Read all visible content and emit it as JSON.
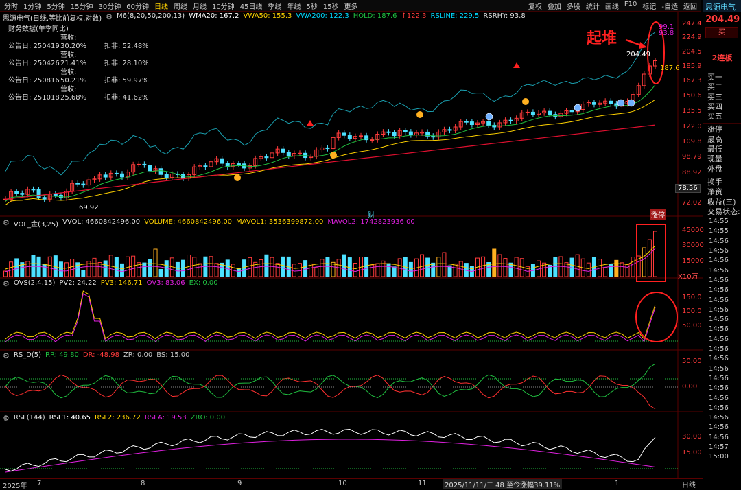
{
  "toolbar": {
    "periods": [
      "分时",
      "1分钟",
      "5分钟",
      "15分钟",
      "30分钟",
      "60分钟",
      "日线",
      "周线",
      "月线",
      "10分钟",
      "45日线",
      "季线",
      "年线",
      "5秒",
      "15秒",
      "更多"
    ],
    "active_period": "日线",
    "tools": [
      "复权",
      "叠加",
      "多股",
      "统计",
      "画线",
      "F10",
      "标记",
      "-自选",
      "返回"
    ]
  },
  "main": {
    "title": "思源电气(日线,等比前复权,对数)",
    "indicator_name": "M6(8,20,50,200,13)",
    "wma20": "WMA20: 167.2",
    "vwa50": "VWA50: 155.3",
    "vwa200": "VWA200: 122.3",
    "hold": "HOLD: 187.6",
    "hold_sep": "↑122.3",
    "rsline": "RSLINE: 229.5",
    "rsrhy": "RSRHY: 93.8",
    "y_labels": [
      "247.4",
      "224.9",
      "204.5",
      "185.9",
      "167.3",
      "150.6",
      "135.5",
      "122.0",
      "109.8",
      "98.79",
      "88.92",
      "78.56",
      "72.02"
    ],
    "low_label": "69.92",
    "hi_label": "204.49",
    "hold_label": "187.6",
    "r_label1": "99.1",
    "r_label2": "93.8",
    "cai_label": "财",
    "zhangting_label": "涨停",
    "annotation": "起堆"
  },
  "financials": {
    "title": "财务数据(单季同比)",
    "rows": [
      {
        "date": "公告日: 250419",
        "rev": "营收: 30.20%",
        "np": "扣非: 52.48%"
      },
      {
        "date": "公告日: 250426",
        "rev": "营收: 21.41%",
        "np": "扣非: 28.10%"
      },
      {
        "date": "公告日: 250816",
        "rev": "营收: 50.21%",
        "np": "扣非: 59.97%"
      },
      {
        "date": "公告日: 251018",
        "rev": "营收: 25.68%",
        "np": "扣非: 41.62%"
      }
    ]
  },
  "vol": {
    "name": "VOL_金(3,25)",
    "vvol": "VVOL: 4660842496.00",
    "volume": "VOLUME: 4660842496.00",
    "mavol1": "MAVOL1: 3536399872.00",
    "mavol2": "MAVOL2: 1742823936.00",
    "y_labels": [
      "45000",
      "30000",
      "15000"
    ],
    "unit": "X10万"
  },
  "ovs": {
    "name": "OVS(2,4,15)",
    "pv2": "PV2: 24.22",
    "pv3": "PV3: 146.71",
    "ov3": "OV3: 83.06",
    "ex": "EX: 0.00",
    "y_labels": [
      "150.0",
      "100.0",
      "50.00"
    ]
  },
  "rsd": {
    "name": "RS_D(5)",
    "rr": "RR: 49.80",
    "dr": "DR: -48.98",
    "zr": "ZR: 0.00",
    "bs": "BS: 15.00",
    "y_labels": [
      "50.00",
      "0.00"
    ]
  },
  "rsl": {
    "name": "RSL(144)",
    "rsl1": "RSL1: 40.65",
    "rsl2": "RSL2: 236.72",
    "rsla": "RSLA: 19.53",
    "zro": "ZRO: 0.00",
    "y_labels": [
      "30.00",
      "15.00"
    ]
  },
  "xaxis": {
    "year": "2025年",
    "months": [
      "7",
      "8",
      "9",
      "10",
      "11",
      "1"
    ],
    "status": "2025/11/11/二 48 至今涨幅39.11%",
    "day": "日线"
  },
  "right_panel": {
    "name": "思源电气",
    "price": "204.49",
    "buy": "买",
    "board": "2连板",
    "orders": [
      "买一",
      "买二",
      "买三",
      "买四",
      "买五"
    ],
    "fields": [
      "涨停",
      "最高",
      "最低",
      "现量",
      "外盘"
    ],
    "fields2": [
      "换手",
      "净资",
      "收益(三)"
    ],
    "status": "交易状态: 连续",
    "times": [
      "14:55",
      "14:55",
      "14:56",
      "14:56",
      "14:56",
      "14:56",
      "14:56",
      "14:56",
      "14:56",
      "14:56",
      "14:56",
      "14:56",
      "14:56",
      "14:56",
      "14:56",
      "14:56",
      "14:56",
      "14:56",
      "14:56",
      "14:56",
      "14:56",
      "14:56",
      "14:56",
      "14:57",
      "15:00"
    ]
  },
  "colors": {
    "up": "#ff3b3b",
    "down": "#4de0ff",
    "wma20": "#ffffff",
    "vwa50": "#ffd200",
    "vwa200": "#00d8ff",
    "hold": "#20c040",
    "rsline": "#e020e0",
    "annotation": "#ff2020"
  }
}
